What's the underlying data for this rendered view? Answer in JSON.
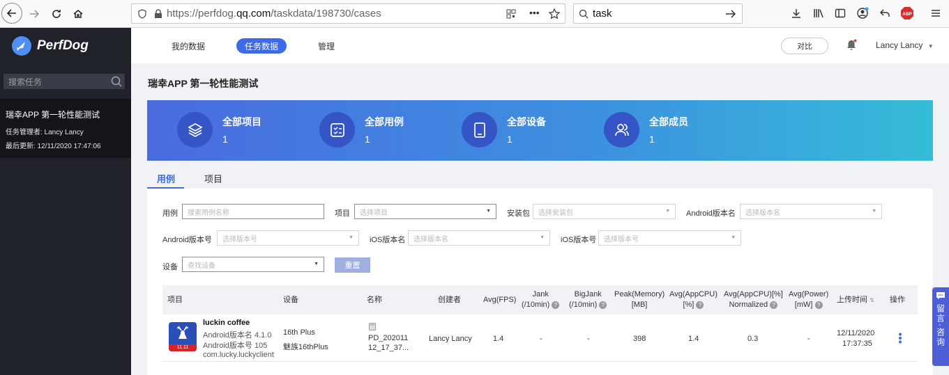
{
  "browser": {
    "url_prefix": "https://perfdog.",
    "url_domain": "qq.com",
    "url_path": "/taskdata/198730/cases",
    "search_text": "task"
  },
  "sidebar": {
    "logo_text": "PerfDog",
    "search_placeholder": "搜索任务",
    "task": {
      "name": "瑞幸APP 第一轮性能测试",
      "manager": "任务管理者: Lancy Lancy",
      "updated": "最后更新: 12/11/2020 17:47:06"
    }
  },
  "header": {
    "tabs": [
      "我的数据",
      "任务数据",
      "管理"
    ],
    "active_tab": "任务数据",
    "compare_label": "对比",
    "user_name": "Lancy Lancy"
  },
  "main": {
    "title": "瑞幸APP 第一轮性能测试",
    "stats": [
      {
        "label": "全部项目",
        "value": "1",
        "icon": "layers-icon"
      },
      {
        "label": "全部用例",
        "value": "1",
        "icon": "checklist-icon"
      },
      {
        "label": "全部设备",
        "value": "1",
        "icon": "tablet-icon"
      },
      {
        "label": "全部成员",
        "value": "1",
        "icon": "users-icon"
      }
    ],
    "sub_tabs": [
      "用例",
      "项目"
    ],
    "active_sub_tab": "用例"
  },
  "filters": {
    "case_label": "用例",
    "case_placeholder": "搜索用例名称",
    "project_label": "项目",
    "project_placeholder": "选择项目",
    "package_label": "安装包",
    "package_placeholder": "选择安装包",
    "android_name_label": "Android版本名",
    "android_name_placeholder": "选择版本名",
    "android_code_label": "Android版本号",
    "android_code_placeholder": "选择版本号",
    "ios_name_label": "iOS版本名",
    "ios_name_placeholder": "选择版本名",
    "ios_code_label": "iOS版本号",
    "ios_code_placeholder": "选择版本号",
    "device_label": "设备",
    "device_placeholder": "查找设备",
    "reset_label": "重置"
  },
  "table": {
    "headers": {
      "project": "项目",
      "device": "设备",
      "name": "名称",
      "creator": "创建者",
      "avg_fps": "Avg(FPS)",
      "jank_1": "Jank",
      "jank_2": "(/10min)",
      "bigjank_1": "BigJank",
      "bigjank_2": "(/10min)",
      "peak_mem_1": "Peak(Memory)",
      "peak_mem_2": "[MB]",
      "avg_cpu_1": "Avg(AppCPU)",
      "avg_cpu_2": "[%]",
      "avg_cpu_norm_1": "Avg(AppCPU)[%]",
      "avg_cpu_norm_2": "Normalized",
      "avg_power_1": "Avg(Power)",
      "avg_power_2": "[mW]",
      "upload_time": "上传时间",
      "actions": "操作"
    },
    "row": {
      "app_name": "luckin coffee",
      "android_version_name": "Android版本名 4.1.0",
      "android_version_code": "Android版本号 105",
      "package": "com.lucky.luckyclient",
      "icon_badge": "11.11",
      "device_1": "16th Plus",
      "device_2": "魅族16thPlus",
      "name_1": "PD_202011",
      "name_2": "12_17_37...",
      "creator": "Lancy Lancy",
      "avg_fps": "1.4",
      "jank": "-",
      "bigjank": "-",
      "peak_mem": "398",
      "avg_cpu": "1.4",
      "avg_cpu_norm": "0.3",
      "avg_power": "-",
      "upload_date": "12/11/2020",
      "upload_time": "17:37:35"
    }
  },
  "float_widget": {
    "label": "留言·咨询"
  }
}
